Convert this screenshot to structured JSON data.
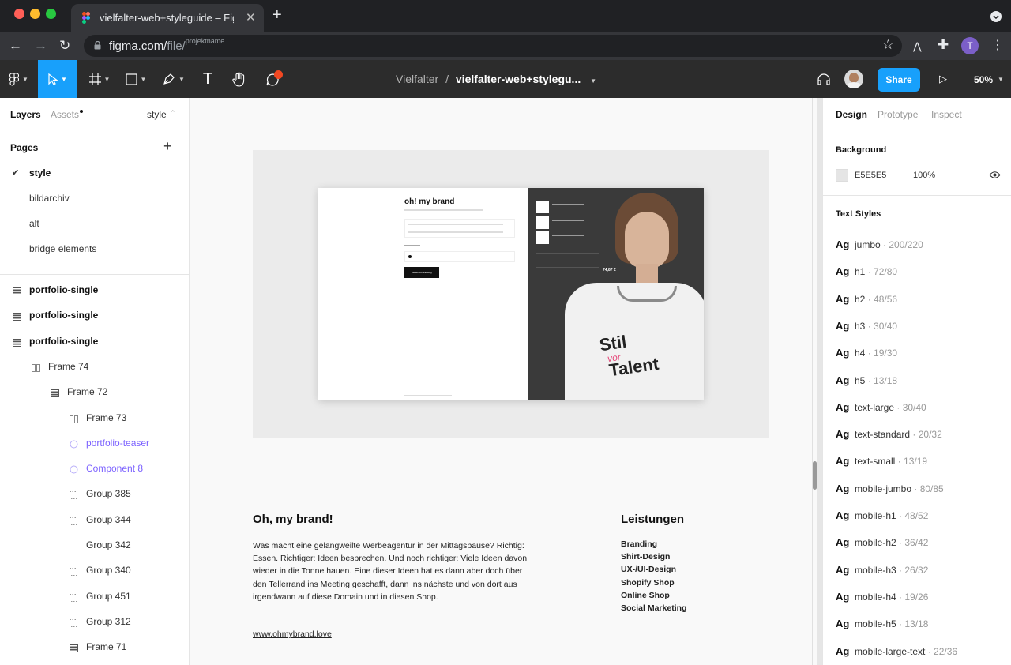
{
  "browser": {
    "tab_title": "vielfalter-web+styleguide – Fig",
    "url_host": "figma.com/",
    "url_path": "file/",
    "url_sup": "projektname"
  },
  "toolbar": {
    "project": "Vielfalter",
    "separator": "/",
    "file": "vielfalter-web+stylegu...",
    "share_label": "Share",
    "zoom": "50%",
    "avatar_initial": "T"
  },
  "left_panel": {
    "tabs": {
      "layers": "Layers",
      "assets": "Assets",
      "page_select": "style"
    },
    "pages_title": "Pages",
    "pages": [
      {
        "label": "style",
        "active": true
      },
      {
        "label": "bildarchiv",
        "active": false
      },
      {
        "label": "alt",
        "active": false
      },
      {
        "label": "bridge elements",
        "active": false
      }
    ],
    "layers": [
      {
        "label": "portfolio-single",
        "type": "frame-list",
        "indent": 0,
        "bold": true
      },
      {
        "label": "portfolio-single",
        "type": "frame-list",
        "indent": 0,
        "bold": true
      },
      {
        "label": "portfolio-single",
        "type": "frame-list",
        "indent": 0,
        "bold": true
      },
      {
        "label": "Frame 74",
        "type": "frame-cols",
        "indent": 1
      },
      {
        "label": "Frame 72",
        "type": "frame-list",
        "indent": 2
      },
      {
        "label": "Frame 73",
        "type": "frame-cols",
        "indent": 3
      },
      {
        "label": "portfolio-teaser",
        "type": "component",
        "indent": 3
      },
      {
        "label": "Component 8",
        "type": "component",
        "indent": 3
      },
      {
        "label": "Group 385",
        "type": "group",
        "indent": 3
      },
      {
        "label": "Group 344",
        "type": "group",
        "indent": 3
      },
      {
        "label": "Group 342",
        "type": "group",
        "indent": 3
      },
      {
        "label": "Group 340",
        "type": "group",
        "indent": 3
      },
      {
        "label": "Group 451",
        "type": "group",
        "indent": 3
      },
      {
        "label": "Group 312",
        "type": "group",
        "indent": 3
      },
      {
        "label": "Frame 71",
        "type": "frame-list",
        "indent": 3
      }
    ]
  },
  "right_panel": {
    "tabs": {
      "design": "Design",
      "prototype": "Prototype",
      "inspect": "Inspect"
    },
    "background_title": "Background",
    "background_hex": "E5E5E5",
    "background_opacity": "100%",
    "text_styles_title": "Text Styles",
    "text_styles": [
      {
        "name": "jumbo",
        "spec": "200/220"
      },
      {
        "name": "h1",
        "spec": "72/80"
      },
      {
        "name": "h2",
        "spec": "48/56"
      },
      {
        "name": "h3",
        "spec": "30/40"
      },
      {
        "name": "h4",
        "spec": "19/30"
      },
      {
        "name": "h5",
        "spec": "13/18"
      },
      {
        "name": "text-large",
        "spec": "30/40"
      },
      {
        "name": "text-standard",
        "spec": "20/32"
      },
      {
        "name": "text-small",
        "spec": "13/19"
      },
      {
        "name": "mobile-jumbo",
        "spec": "80/85"
      },
      {
        "name": "mobile-h1",
        "spec": "48/52"
      },
      {
        "name": "mobile-h2",
        "spec": "36/42"
      },
      {
        "name": "mobile-h3",
        "spec": "26/32"
      },
      {
        "name": "mobile-h4",
        "spec": "19/26"
      },
      {
        "name": "mobile-h5",
        "spec": "13/18"
      },
      {
        "name": "mobile-large-text",
        "spec": "22/36"
      }
    ]
  },
  "canvas": {
    "mock": {
      "brand": "oh! my brand",
      "button": "Weiter zur Zahlung",
      "total": "74,87 €",
      "shirt_line1": "Stil",
      "shirt_line2": "vor",
      "shirt_line3": "Talent"
    },
    "heading": "Oh, my brand!",
    "body": "Was macht eine gelangweilte Werbeagentur in der Mittagspause? Richtig: Essen. Richtiger: Ideen besprechen. Und noch richtiger: Viele Ideen davon wieder in die Tonne hauen. Eine dieser Ideen hat es dann aber doch über den Tellerrand ins Meeting geschafft, dann ins nächste und von dort aus irgendwann auf diese Domain und in diesen Shop.",
    "link": "www.ohmybrand.love",
    "services_title": "Leistungen",
    "services": [
      "Branding",
      "Shirt-Design",
      "UX-/UI-Design",
      "Shopify Shop",
      "Online Shop",
      "Social Marketing"
    ]
  },
  "colors": {
    "accent": "#18a0fb",
    "component": "#7b61ff",
    "notification": "#f24822",
    "avatar": "#7b5fc8"
  }
}
